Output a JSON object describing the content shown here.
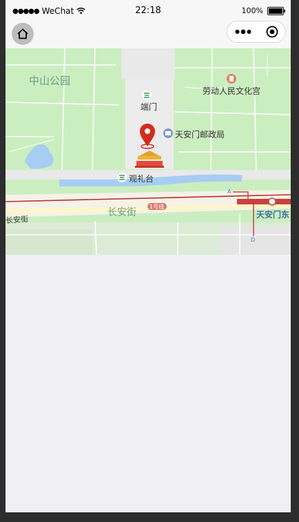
{
  "status_bar": {
    "carrier": "WeChat",
    "signal_dots": "●●●●●",
    "time": "22:18",
    "battery_text": "100%"
  },
  "nav": {
    "home_icon": "home-icon",
    "more_icon": "more-dots-icon",
    "close_icon": "target-circle-icon"
  },
  "map": {
    "labels": {
      "park": "中山公园",
      "palace": "劳动人民文化宫",
      "gate": "端门",
      "post_office": "天安门邮政局",
      "viewing_stand": "观礼台",
      "avenue": "长安街",
      "avenue_left": "长安街",
      "metro_line": "1号线",
      "station": "天安门东",
      "exit_a": "A",
      "exit_d": "D"
    },
    "marker_icon": "map-pin-icon",
    "colors": {
      "green": "#cbeec0",
      "water": "#a7cdf2",
      "road": "#ffffff",
      "metro": "#c9423b"
    }
  }
}
